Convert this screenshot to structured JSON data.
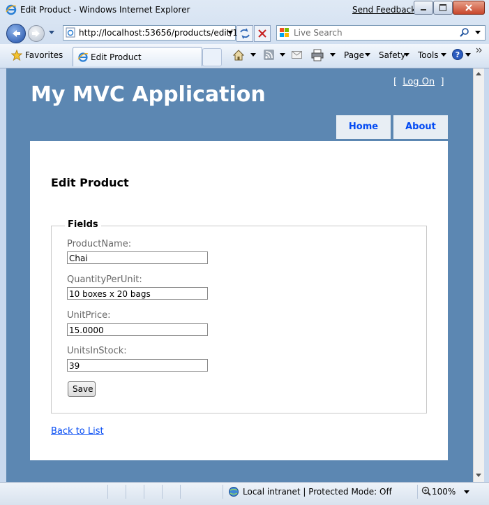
{
  "window": {
    "title": "Edit Product - Windows Internet Explorer",
    "send_feedback": "Send Feedback"
  },
  "browser": {
    "address": "http://localhost:53656/products/edit/1",
    "search_placeholder": "Live Search",
    "favorites_label": "Favorites",
    "tab_label": "Edit Product",
    "commands": {
      "page": "Page",
      "safety": "Safety",
      "tools": "Tools"
    }
  },
  "site": {
    "title": "My MVC Application",
    "logon_open": "[",
    "logon_label": "Log On",
    "logon_close": "]",
    "nav": {
      "home": "Home",
      "about": "About"
    }
  },
  "page": {
    "heading": "Edit Product",
    "legend": "Fields",
    "fields": {
      "product_name": {
        "label": "ProductName:",
        "value": "Chai"
      },
      "quantity_per_unit": {
        "label": "QuantityPerUnit:",
        "value": "10 boxes x 20 bags"
      },
      "unit_price": {
        "label": "UnitPrice:",
        "value": "15.0000"
      },
      "units_in_stock": {
        "label": "UnitsInStock:",
        "value": "39"
      }
    },
    "save_label": "Save",
    "back_link": "Back to List"
  },
  "status": {
    "zone": "Local intranet | Protected Mode: Off",
    "zoom": "100%"
  },
  "colors": {
    "page_background": "#5c87b2",
    "nav_tab_bg": "#e8eef4",
    "link": "#034af3"
  }
}
